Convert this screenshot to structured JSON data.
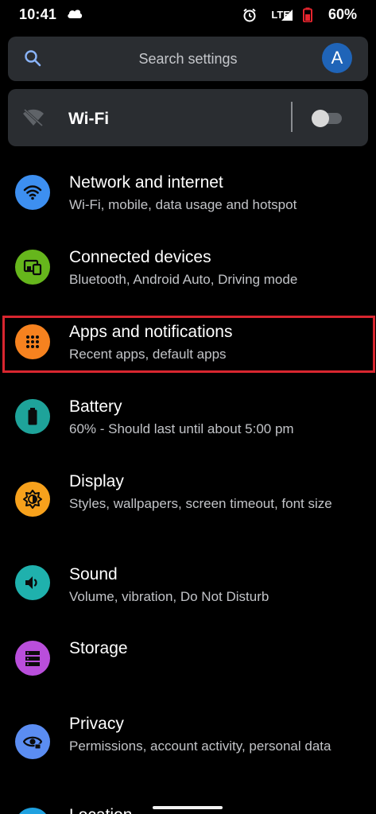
{
  "status_bar": {
    "time": "10:41",
    "network": "LTE",
    "battery": "60%"
  },
  "search": {
    "placeholder": "Search settings",
    "avatar_letter": "A"
  },
  "wifi_card": {
    "label": "Wi-Fi",
    "enabled": false
  },
  "settings": [
    {
      "title": "Network and internet",
      "subtitle": "Wi-Fi, mobile, data usage and hotspot",
      "icon": "wifi-icon",
      "color": "#3d8ff0"
    },
    {
      "title": "Connected devices",
      "subtitle": "Bluetooth, Android Auto, Driving mode",
      "icon": "devices-icon",
      "color": "#66b61c"
    },
    {
      "title": "Apps and notifications",
      "subtitle": "Recent apps, default apps",
      "icon": "apps-grid-icon",
      "color": "#f6821f"
    },
    {
      "title": "Battery",
      "subtitle": "60% - Should last until about 5:00 pm",
      "icon": "battery-icon",
      "color": "#1ea39a"
    },
    {
      "title": "Display",
      "subtitle": "Styles, wallpapers, screen timeout, font size",
      "icon": "brightness-icon",
      "color": "#f7a11c"
    },
    {
      "title": "Sound",
      "subtitle": "Volume, vibration, Do Not Disturb",
      "icon": "speaker-icon",
      "color": "#1fb1ad"
    },
    {
      "title": "Storage",
      "subtitle": "",
      "icon": "storage-icon",
      "color": "#b94edb"
    },
    {
      "title": "Privacy",
      "subtitle": "Permissions, account activity, personal data",
      "icon": "eye-icon",
      "color": "#5b8df2"
    },
    {
      "title": "Location",
      "subtitle": "",
      "icon": "location-icon",
      "color": "#1fa1e0"
    }
  ],
  "colors": {
    "background": "#000000",
    "card": "#2a2d31",
    "highlight": "#d8262f",
    "subtitle_text": "#c2c4c8"
  }
}
